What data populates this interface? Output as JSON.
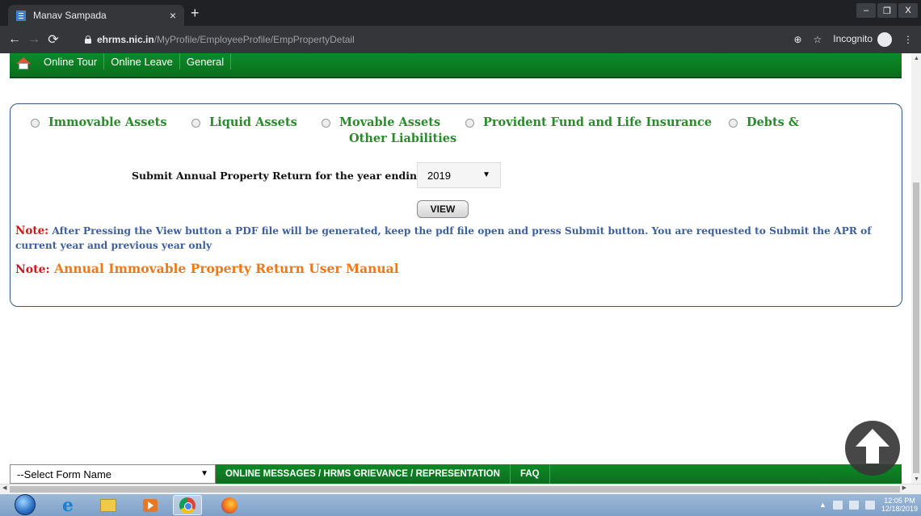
{
  "browser": {
    "tab_title": "Manav Sampada",
    "tab_close": "×",
    "new_tab": "+",
    "url_host": "ehrms.nic.in",
    "url_path": "/MyProfile/EmployeeProfile/EmpPropertyDetail",
    "incognito_label": "Incognito",
    "window_controls": [
      "–",
      "❐",
      "X"
    ]
  },
  "topnav": {
    "items": [
      "Online Tour",
      "Online Leave",
      "General"
    ]
  },
  "property_form": {
    "asset_options": [
      {
        "label": "Immovable Assets"
      },
      {
        "label": "Liquid Assets"
      },
      {
        "label": "Movable Assets"
      },
      {
        "label": "Provident Fund and Life Insurance"
      },
      {
        "label": "Debts &",
        "label2": "Other Liabilities"
      }
    ],
    "year_label": "Submit Annual Property Return for the year ending",
    "year_value": "2019",
    "view_button": "VIEW",
    "note1_label": "Note:",
    "note1_text": " After Pressing the View button a PDF file will be generated, keep the pdf file open and press Submit button. You are requested to Submit the APR of current year and previous year only",
    "note2_label": "Note:",
    "note2_link": "Annual Immovable Property Return User Manual"
  },
  "footer_bar": {
    "select_value": "--Select Form Name",
    "links": [
      "ONLINE MESSAGES / HRMS GRIEVANCE / REPRESENTATION",
      "FAQ"
    ]
  },
  "taskbar": {
    "clock_time": "12:05 PM",
    "clock_date": "12/18/2019"
  },
  "colors": {
    "brand_green": "#0a7a21",
    "option_green": "#2b8a2b",
    "note_red": "#d01818",
    "note_blue": "#3c5f9e",
    "link_orange": "#f07818"
  }
}
